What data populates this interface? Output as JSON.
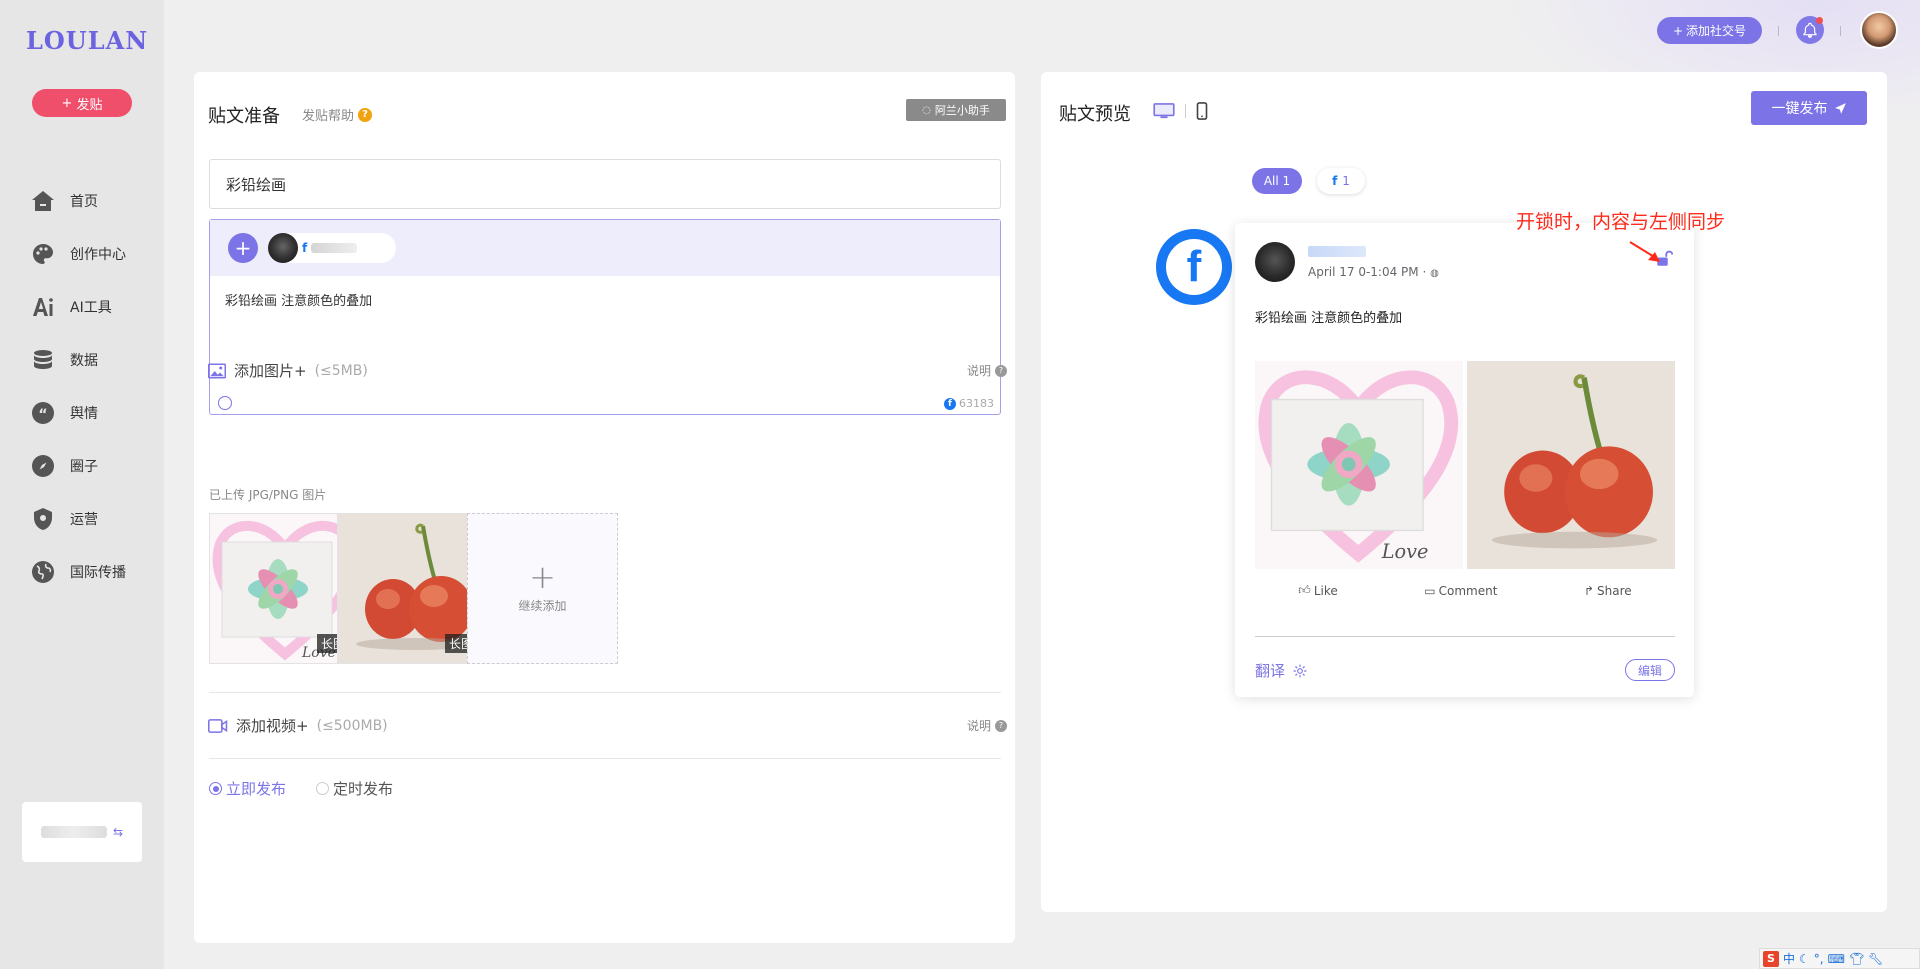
{
  "app": {
    "logo": "LOULAN"
  },
  "sidebar": {
    "post_button": "发贴",
    "items": [
      {
        "label": "首页",
        "icon": "home-icon"
      },
      {
        "label": "创作中心",
        "icon": "palette-icon"
      },
      {
        "label": "AI工具",
        "icon": "ai-icon"
      },
      {
        "label": "数据",
        "icon": "database-icon"
      },
      {
        "label": "舆情",
        "icon": "quote-icon"
      },
      {
        "label": "圈子",
        "icon": "compass-icon"
      },
      {
        "label": "运营",
        "icon": "shield-icon"
      },
      {
        "label": "国际传播",
        "icon": "globe-icon"
      }
    ],
    "workspace_switch_icon": "swap-icon"
  },
  "topbar": {
    "add_social_label": "添加社交号"
  },
  "compose": {
    "title": "贴文准备",
    "help_label": "发贴帮助",
    "assistant_label": "阿兰小助手",
    "title_value": "彩铅绘画",
    "body_text": "彩铅绘画 注意颜色的叠加",
    "char_count": "63183",
    "images": {
      "label": "添加图片+",
      "limit": "(≤5MB)",
      "note": "说明",
      "uploaded_label": "已上传 JPG/PNG 图片",
      "items": [
        {
          "badge": "长图"
        },
        {
          "badge": "长图"
        }
      ],
      "add_more_label": "继续添加"
    },
    "video": {
      "label": "添加视频+",
      "limit": "(≤500MB)",
      "note": "说明"
    },
    "publish_modes": [
      {
        "label": "立即发布",
        "selected": true
      },
      {
        "label": "定时发布",
        "selected": false
      }
    ]
  },
  "preview": {
    "title": "贴文预览",
    "publish_button": "一键发布",
    "filters": {
      "all": "All 1",
      "facebook_count": "1"
    },
    "post": {
      "date": "April 17 0-1:04 PM ·",
      "text": "彩铅绘画 注意颜色的叠加",
      "actions": [
        "Like",
        "Comment",
        "Share"
      ],
      "translate_label": "翻译",
      "edit_label": "编辑"
    },
    "annotation": "开锁时，内容与左侧同步"
  },
  "colors": {
    "accent": "#7c74e6",
    "post_button": "#ef4f6b",
    "facebook": "#1877f2",
    "annotation": "#ff2a1a"
  },
  "tray": {
    "ime_lang": "中"
  }
}
